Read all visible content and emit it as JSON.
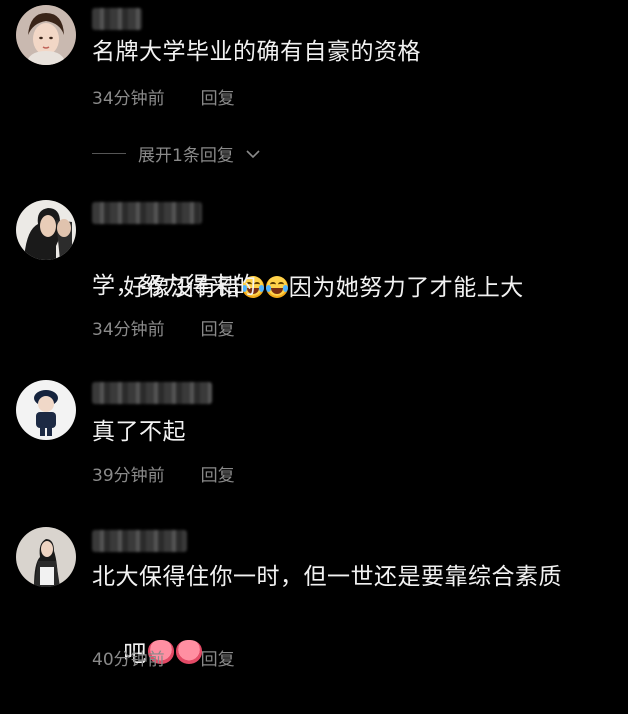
{
  "comments": [
    {
      "text": "名牌大学毕业的确有自豪的资格",
      "time": "34分钟前",
      "reply": "回复"
    },
    {
      "text_before": "好像没有错",
      "emojis": [
        "laugh-cry-emoji",
        "laugh-cry-emoji"
      ],
      "text_after": "因为她努力了才能上大",
      "text_line2": "学，努力得来的",
      "time": "34分钟前",
      "reply": "回复"
    },
    {
      "text": "真了不起",
      "time": "39分钟前",
      "reply": "回复"
    },
    {
      "text_line1": "北大保得住你一时，但一世还是要靠综合素质",
      "text_line2": "吧",
      "emojis": [
        "heart-emoji",
        "heart-emoji"
      ],
      "time": "40分钟前",
      "reply": "回复"
    }
  ],
  "expand_replies": "展开1条回复",
  "colors": {
    "background": "#000000",
    "text": "#f2f2f2",
    "meta": "#8a8a8a"
  }
}
